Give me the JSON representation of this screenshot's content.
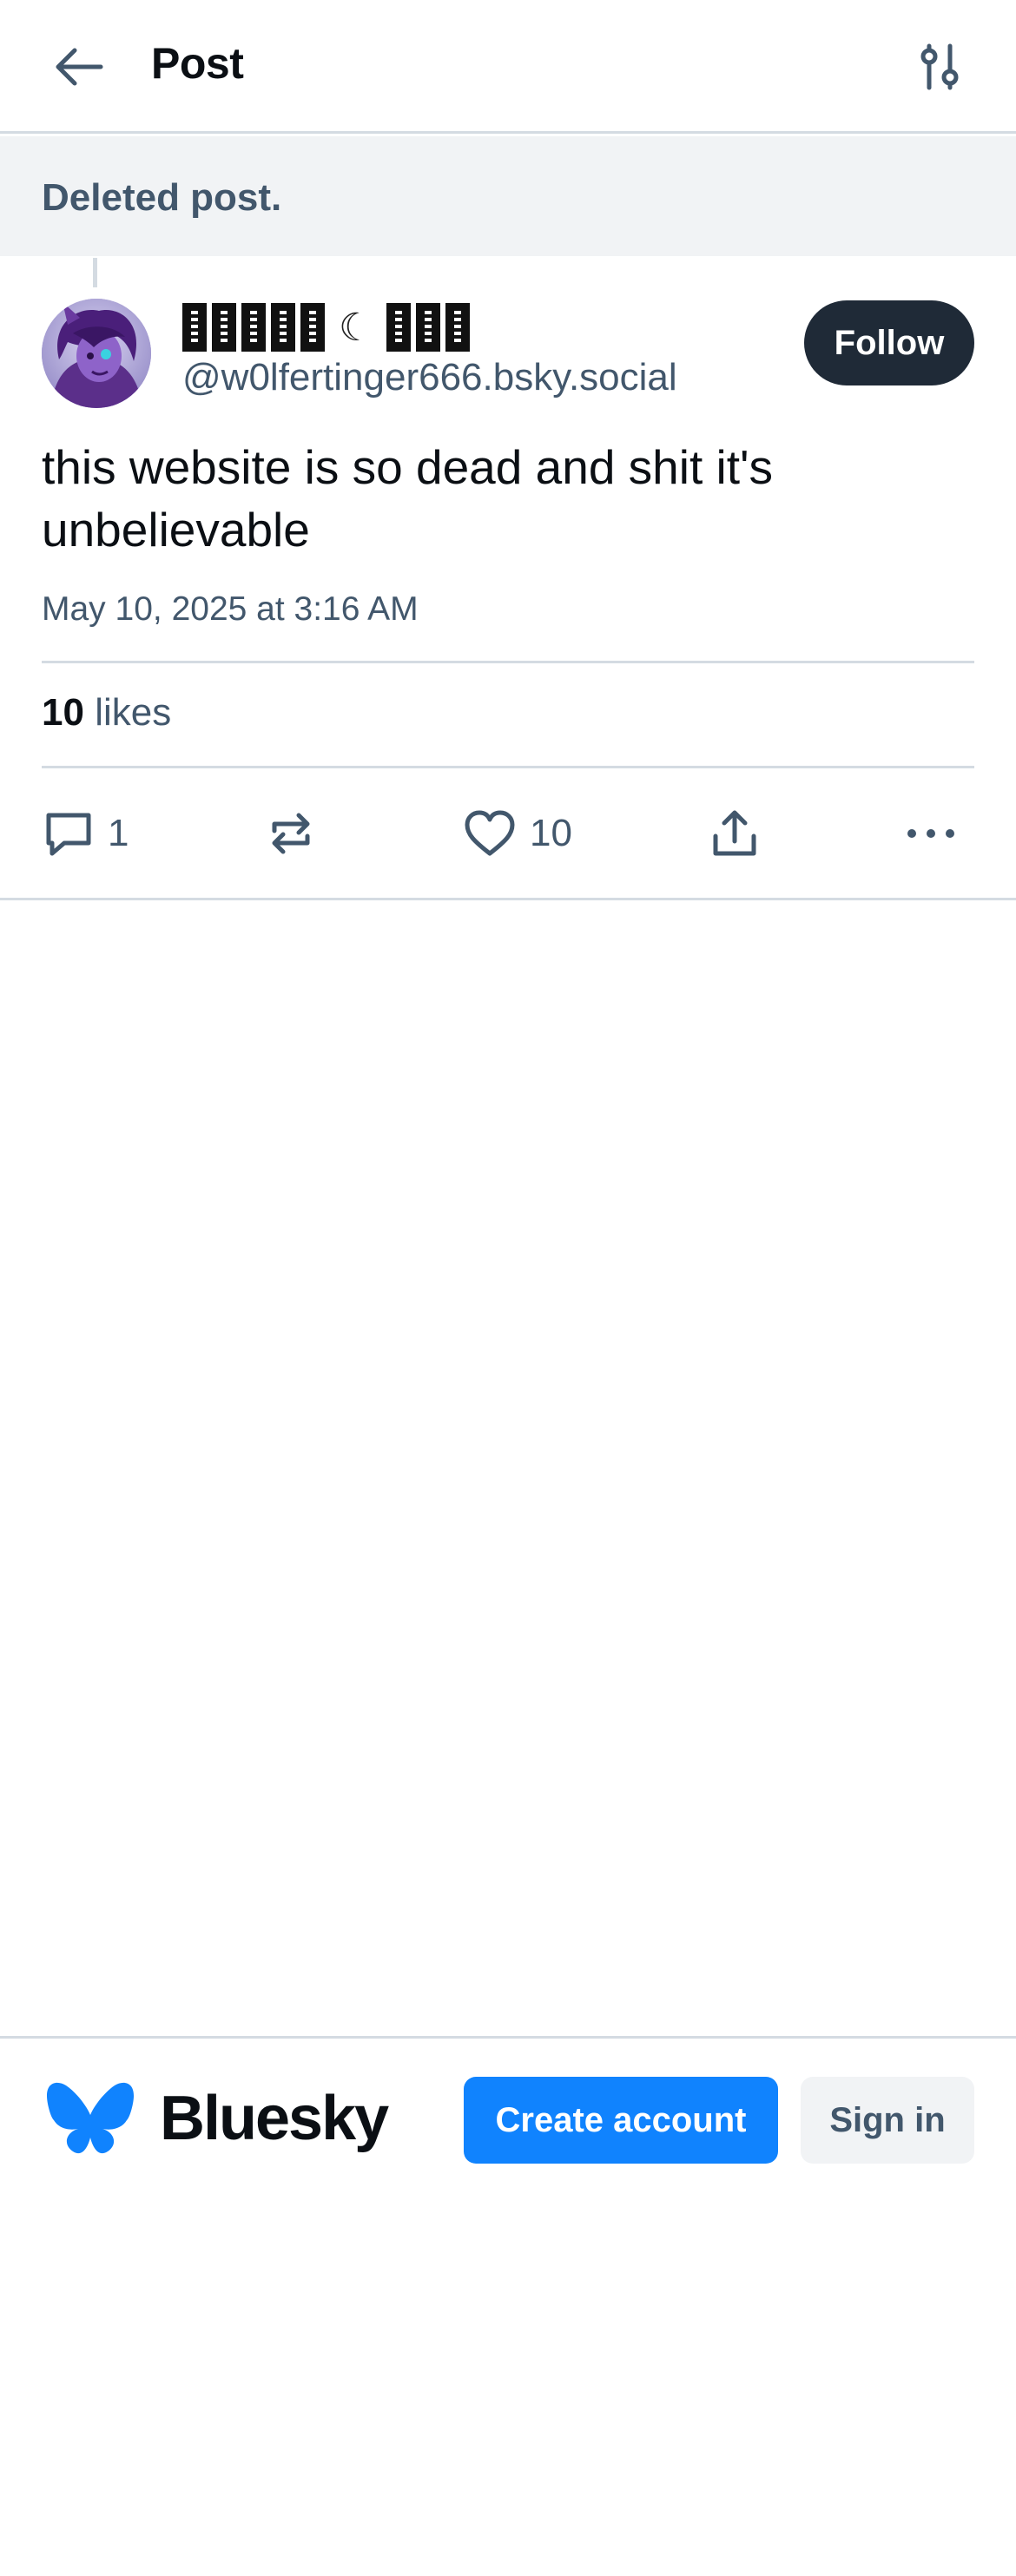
{
  "header": {
    "title": "Post",
    "back_icon": "arrow-left-icon",
    "settings_icon": "sliders-icon"
  },
  "deleted_banner": {
    "text": "Deleted post."
  },
  "post": {
    "author": {
      "display_name_moon": "☾",
      "handle": "@w0lfertinger666.bsky.social",
      "avatar_icon": "avatar"
    },
    "follow_label": "Follow",
    "text": "this website is so dead and shit it's unbelievable",
    "date": "May 10, 2025 at 3:16 AM",
    "likes": {
      "count": "10",
      "label": "likes"
    },
    "actions": {
      "reply_count": "1",
      "like_count": "10"
    }
  },
  "footer": {
    "brand_name": "Bluesky",
    "create_account_label": "Create account",
    "sign_in_label": "Sign in",
    "brand_color": "#1083fe"
  }
}
